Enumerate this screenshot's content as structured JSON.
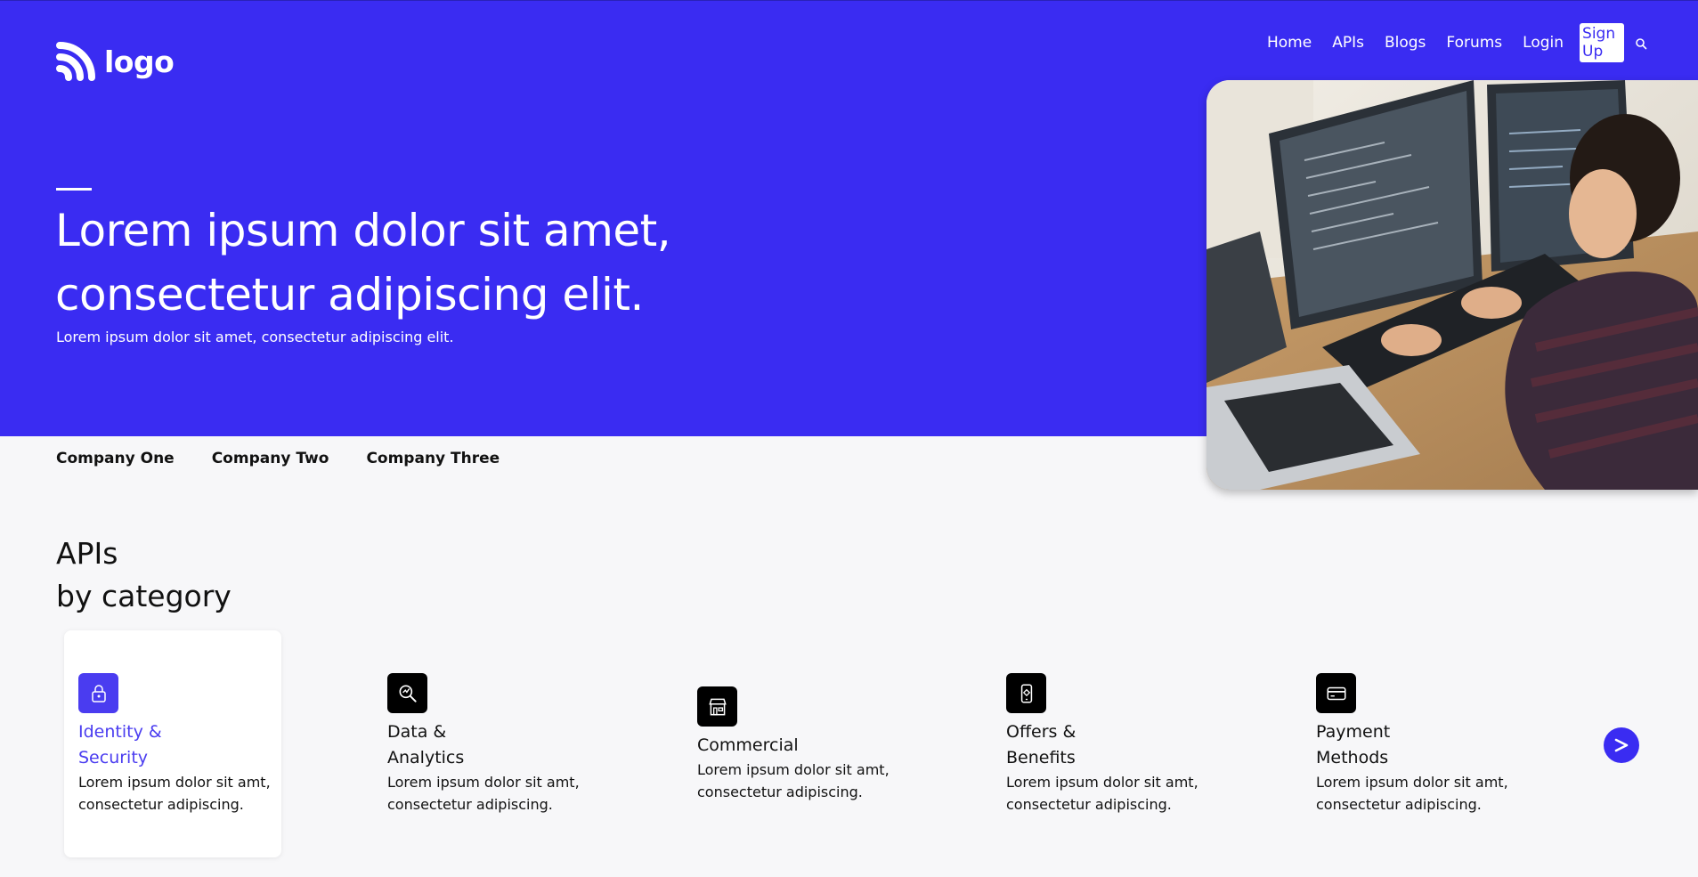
{
  "header": {
    "logo_text": "logo",
    "nav": [
      {
        "label": "Home"
      },
      {
        "label": "APIs"
      },
      {
        "label": "Blogs"
      },
      {
        "label": "Forums"
      },
      {
        "label": "Login"
      }
    ],
    "signup_label": "Sign Up",
    "search_icon": "search-icon"
  },
  "hero": {
    "title": "Lorem ipsum dolor sit amet, consectetur adipiscing elit.",
    "subtitle": "Lorem ipsum dolor sit amet, consectetur adipiscing elit.",
    "background_color": "#3a2cf2"
  },
  "companies": [
    "Company One",
    "Company Two",
    "Company Three"
  ],
  "section": {
    "title_line1": "APIs",
    "title_line2": "by category"
  },
  "categories": [
    {
      "title_line1": "Identity &",
      "title_line2": "Security",
      "desc_line1": "Lorem ipsum dolor sit amt,",
      "desc_line2": "consectetur adipiscing.",
      "icon": "lock-icon",
      "active": true
    },
    {
      "title_line1": "Data &",
      "title_line2": "Analytics",
      "desc_line1": "Lorem ipsum dolor sit amt,",
      "desc_line2": "consectetur adipiscing.",
      "icon": "analytics-icon",
      "active": false
    },
    {
      "title_line1": "Commercial",
      "title_line2": "",
      "desc_line1": "Lorem ipsum dolor sit amt,",
      "desc_line2": "consectetur adipiscing.",
      "icon": "store-icon",
      "active": false
    },
    {
      "title_line1": "Offers &",
      "title_line2": "Benefits",
      "desc_line1": "Lorem ipsum dolor sit amt,",
      "desc_line2": "consectetur adipiscing.",
      "icon": "mobile-offer-icon",
      "active": false
    },
    {
      "title_line1": "Payment",
      "title_line2": "Methods",
      "desc_line1": "Lorem ipsum dolor sit amt,",
      "desc_line2": "consectetur adipiscing.",
      "icon": "credit-card-icon",
      "active": false
    }
  ],
  "colors": {
    "accent": "#3a2cf2",
    "active_text": "#4a3cf0"
  }
}
